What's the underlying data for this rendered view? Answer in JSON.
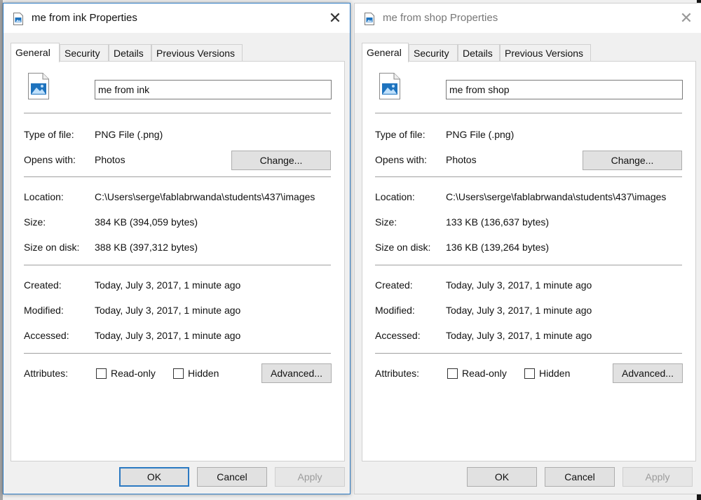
{
  "windows": [
    {
      "title": "me from ink Properties",
      "tabs": [
        "General",
        "Security",
        "Details",
        "Previous Versions"
      ],
      "file_name": "me from ink",
      "type_label": "Type of file:",
      "type_value": "PNG File (.png)",
      "opens_label": "Opens with:",
      "opens_value": "Photos",
      "change_button": "Change...",
      "location_label": "Location:",
      "location_value": "C:\\Users\\serge\\fablabrwanda\\students\\437\\images",
      "size_label": "Size:",
      "size_value": "384 KB (394,059 bytes)",
      "size_disk_label": "Size on disk:",
      "size_disk_value": "388 KB (397,312 bytes)",
      "created_label": "Created:",
      "created_value": "Today, July 3, 2017, 1 minute ago",
      "modified_label": "Modified:",
      "modified_value": "Today, July 3, 2017, 1 minute ago",
      "accessed_label": "Accessed:",
      "accessed_value": "Today, July 3, 2017, 1 minute ago",
      "attributes_label": "Attributes:",
      "readonly_label": "Read-only",
      "hidden_label": "Hidden",
      "advanced_button": "Advanced...",
      "ok_button": "OK",
      "cancel_button": "Cancel",
      "apply_button": "Apply"
    },
    {
      "title": "me from shop Properties",
      "tabs": [
        "General",
        "Security",
        "Details",
        "Previous Versions"
      ],
      "file_name": "me from shop",
      "type_label": "Type of file:",
      "type_value": "PNG File (.png)",
      "opens_label": "Opens with:",
      "opens_value": "Photos",
      "change_button": "Change...",
      "location_label": "Location:",
      "location_value": "C:\\Users\\serge\\fablabrwanda\\students\\437\\images",
      "size_label": "Size:",
      "size_value": "133 KB (136,637 bytes)",
      "size_disk_label": "Size on disk:",
      "size_disk_value": "136 KB (139,264 bytes)",
      "created_label": "Created:",
      "created_value": "Today, July 3, 2017, 1 minute ago",
      "modified_label": "Modified:",
      "modified_value": "Today, July 3, 2017, 1 minute ago",
      "accessed_label": "Accessed:",
      "accessed_value": "Today, July 3, 2017, 1 minute ago",
      "attributes_label": "Attributes:",
      "readonly_label": "Read-only",
      "hidden_label": "Hidden",
      "advanced_button": "Advanced...",
      "ok_button": "OK",
      "cancel_button": "Cancel",
      "apply_button": "Apply"
    }
  ],
  "icons": {
    "title": "image-file-icon",
    "file": "image-file-icon",
    "close": "close-icon"
  },
  "colors": {
    "active_border": "#2b79c2",
    "icon_blue": "#1e73be"
  }
}
